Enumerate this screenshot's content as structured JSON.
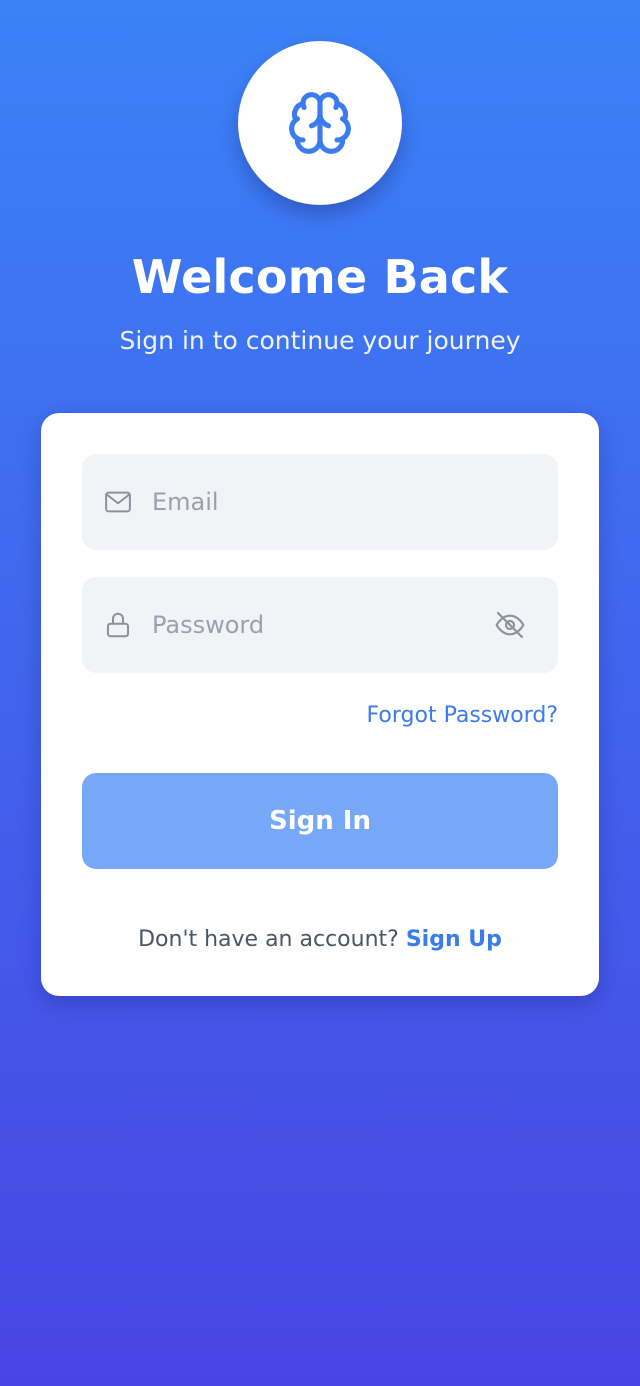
{
  "header": {
    "logo_icon": "brain-icon",
    "title": "Welcome Back",
    "subtitle": "Sign in to continue your journey"
  },
  "form": {
    "email": {
      "icon": "mail-icon",
      "value": "",
      "placeholder": "Email"
    },
    "password": {
      "icon": "lock-icon",
      "value": "",
      "placeholder": "Password",
      "toggle_icon": "eye-off-icon"
    },
    "forgot_label": "Forgot Password?",
    "submit_label": "Sign In",
    "signup_prompt": "Don't have an account?",
    "signup_label": "Sign Up"
  },
  "colors": {
    "gradient_top": "#3b82f6",
    "gradient_bottom": "#4845e4",
    "accent": "#3b7bf0",
    "button": "#77a8f8",
    "field_bg": "#f1f3f7"
  }
}
